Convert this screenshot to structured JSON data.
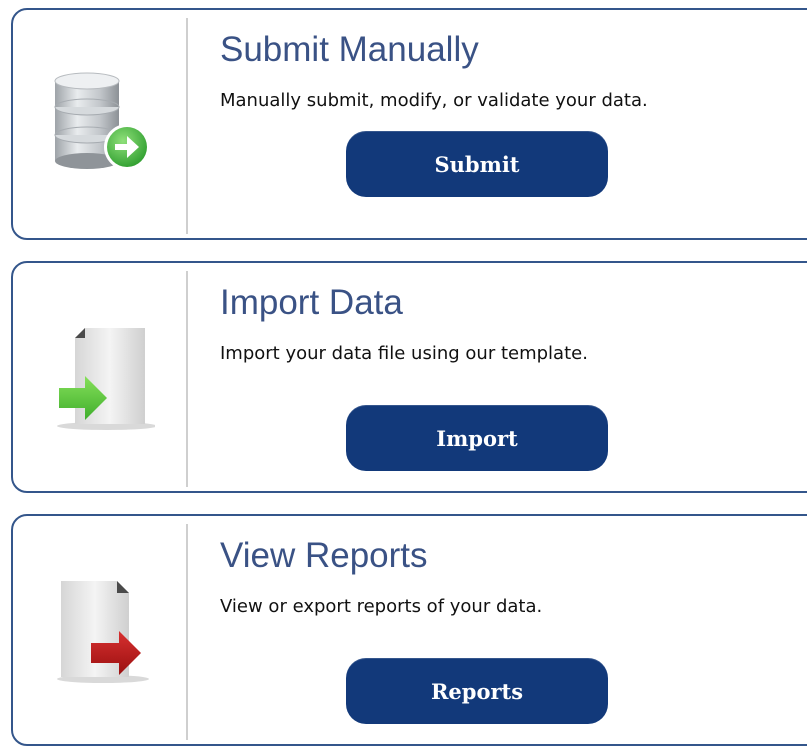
{
  "cards": [
    {
      "id": "submit",
      "title": "Submit Manually",
      "description": "Manually submit, modify, or validate your data.",
      "button_label": "Submit",
      "icon": "database-submit-icon"
    },
    {
      "id": "import",
      "title": "Import Data",
      "description": "Import your data file using our template.",
      "button_label": "Import",
      "icon": "file-import-icon"
    },
    {
      "id": "reports",
      "title": "View Reports",
      "description": "View or export reports of your data.",
      "button_label": "Reports",
      "icon": "file-export-icon"
    }
  ],
  "colors": {
    "border": "#34568b",
    "title": "#3a5285",
    "button_bg": "#12397a",
    "button_text": "#ffffff",
    "import_arrow": "#5cc23a",
    "export_arrow": "#c01c1c",
    "submit_arrow": "#3fae3f"
  }
}
